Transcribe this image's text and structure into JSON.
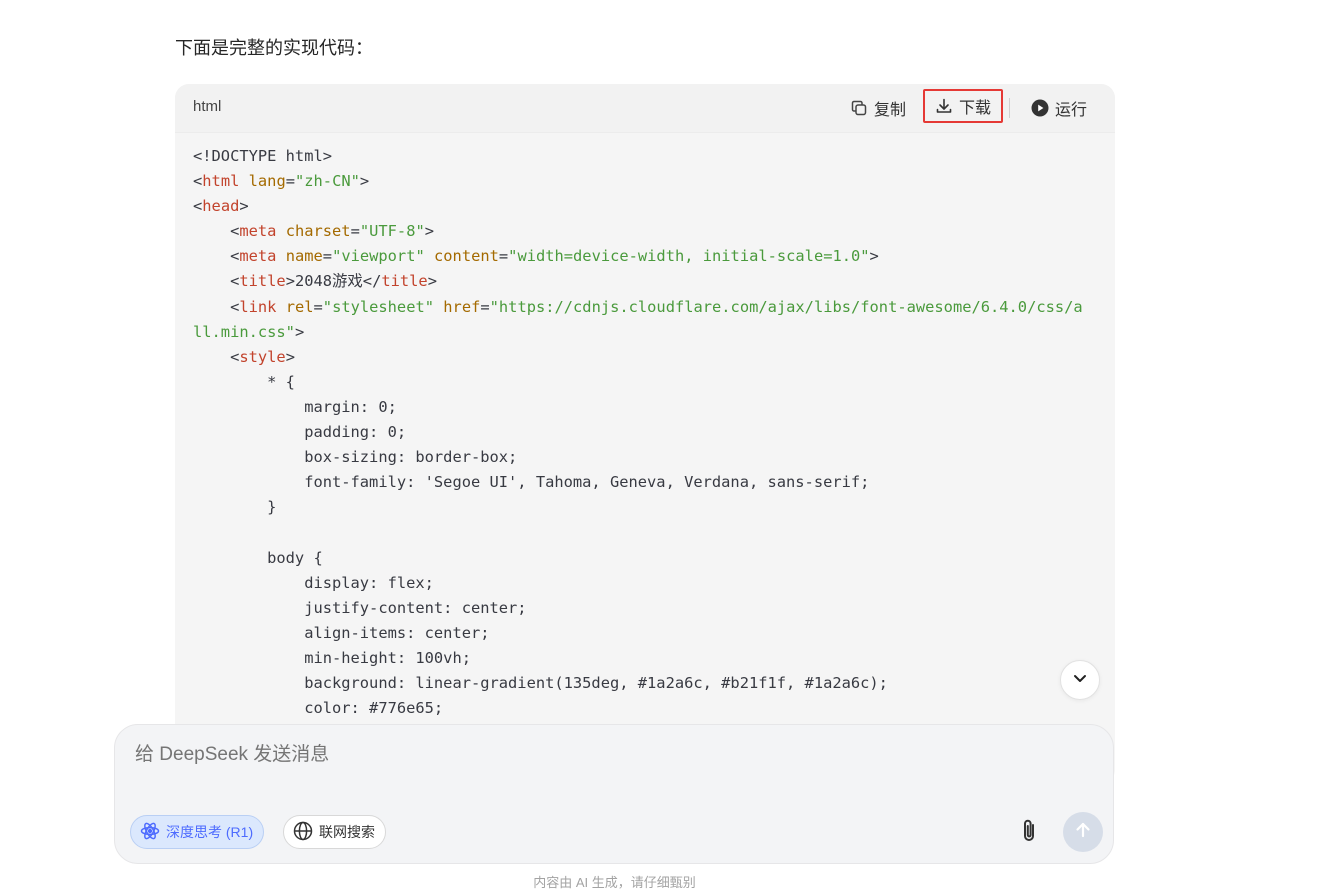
{
  "message": {
    "intro_text": "下面是完整的实现代码："
  },
  "code_block": {
    "language": "html",
    "actions": {
      "copy_label": "复制",
      "download_label": "下载",
      "run_label": "运行"
    },
    "lines": [
      [
        [
          "p",
          "<!DOCTYPE html>"
        ]
      ],
      [
        [
          "p",
          "<"
        ],
        [
          "t",
          "html"
        ],
        [
          "p",
          " "
        ],
        [
          "a",
          "lang"
        ],
        [
          "p",
          "="
        ],
        [
          "s",
          "\"zh-CN\""
        ],
        [
          "p",
          ">"
        ]
      ],
      [
        [
          "p",
          "<"
        ],
        [
          "t",
          "head"
        ],
        [
          "p",
          ">"
        ]
      ],
      [
        [
          "p",
          "    <"
        ],
        [
          "t",
          "meta"
        ],
        [
          "p",
          " "
        ],
        [
          "a",
          "charset"
        ],
        [
          "p",
          "="
        ],
        [
          "s",
          "\"UTF-8\""
        ],
        [
          "p",
          ">"
        ]
      ],
      [
        [
          "p",
          "    <"
        ],
        [
          "t",
          "meta"
        ],
        [
          "p",
          " "
        ],
        [
          "a",
          "name"
        ],
        [
          "p",
          "="
        ],
        [
          "s",
          "\"viewport\""
        ],
        [
          "p",
          " "
        ],
        [
          "a",
          "content"
        ],
        [
          "p",
          "="
        ],
        [
          "s",
          "\"width=device-width, initial-scale=1.0\""
        ],
        [
          "p",
          ">"
        ]
      ],
      [
        [
          "p",
          "    <"
        ],
        [
          "t",
          "title"
        ],
        [
          "p",
          ">2048游戏</"
        ],
        [
          "t",
          "title"
        ],
        [
          "p",
          ">"
        ]
      ],
      [
        [
          "p",
          "    <"
        ],
        [
          "t",
          "link"
        ],
        [
          "p",
          " "
        ],
        [
          "a",
          "rel"
        ],
        [
          "p",
          "="
        ],
        [
          "s",
          "\"stylesheet\""
        ],
        [
          "p",
          " "
        ],
        [
          "a",
          "href"
        ],
        [
          "p",
          "="
        ],
        [
          "s",
          "\"https://cdnjs.cloudflare.com/ajax/libs/font-awesome/6.4.0/css/a"
        ]
      ],
      [
        [
          "s",
          "ll.min.css\""
        ],
        [
          "p",
          ">"
        ]
      ],
      [
        [
          "p",
          "    <"
        ],
        [
          "t",
          "style"
        ],
        [
          "p",
          ">"
        ]
      ],
      [
        [
          "p",
          "        * {"
        ]
      ],
      [
        [
          "p",
          "            margin: 0;"
        ]
      ],
      [
        [
          "p",
          "            padding: 0;"
        ]
      ],
      [
        [
          "p",
          "            box-sizing: border-box;"
        ]
      ],
      [
        [
          "p",
          "            font-family: 'Segoe UI', Tahoma, Geneva, Verdana, sans-serif;"
        ]
      ],
      [
        [
          "p",
          "        }"
        ]
      ],
      [
        [
          "p",
          ""
        ]
      ],
      [
        [
          "p",
          "        body {"
        ]
      ],
      [
        [
          "p",
          "            display: flex;"
        ]
      ],
      [
        [
          "p",
          "            justify-content: center;"
        ]
      ],
      [
        [
          "p",
          "            align-items: center;"
        ]
      ],
      [
        [
          "p",
          "            min-height: 100vh;"
        ]
      ],
      [
        [
          "p",
          "            background: linear-gradient(135deg, #1a2a6c, #b21f1f, #1a2a6c);"
        ]
      ],
      [
        [
          "p",
          "            color: #776e65;"
        ]
      ]
    ]
  },
  "composer": {
    "placeholder": "给 DeepSeek 发送消息",
    "deep_think_label": "深度思考 (R1)",
    "web_search_label": "联网搜索"
  },
  "footer": {
    "disclaimer": "内容由 AI 生成，请仔细甄别"
  },
  "colors": {
    "accent": "#4d6bfe",
    "tag": "#c2432c",
    "attr": "#a46a00",
    "string": "#4a9a3c",
    "highlight_border": "#e53935"
  },
  "icons": [
    "copy-icon",
    "download-icon",
    "play-icon",
    "chevron-down-icon",
    "atom-icon",
    "globe-icon",
    "paperclip-icon",
    "arrow-up-icon"
  ]
}
